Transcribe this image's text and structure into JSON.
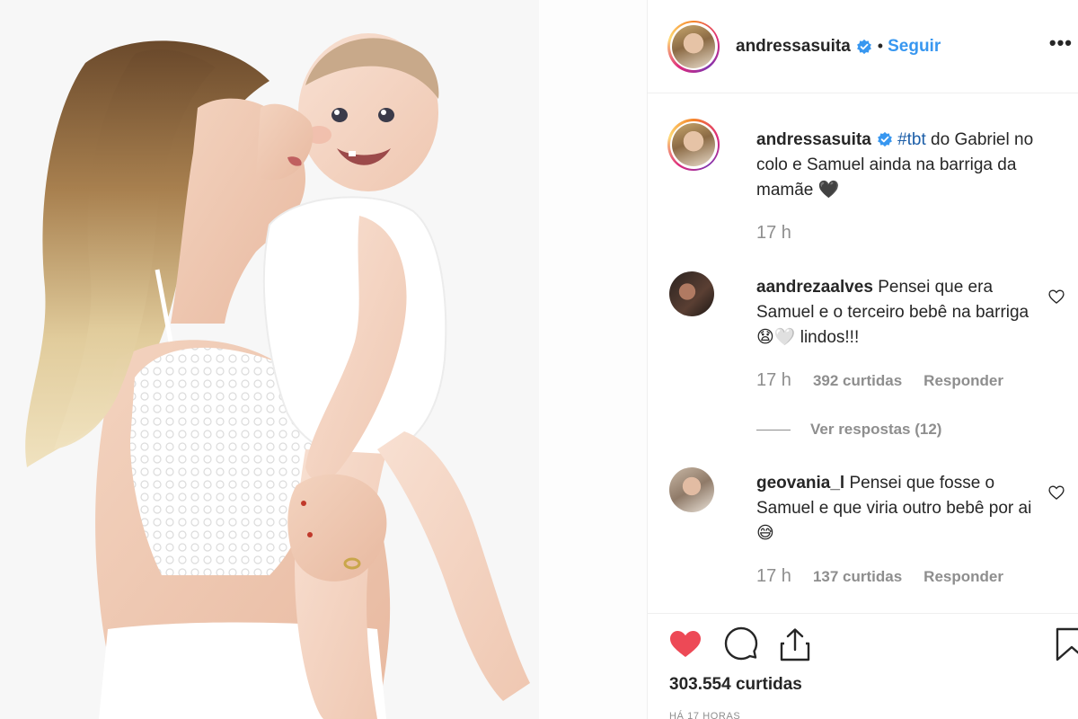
{
  "colors": {
    "link_blue": "#3897f0",
    "liked_red": "#ed4956",
    "verified_blue": "#3897f0",
    "secondary_text": "#8e8e8e"
  },
  "post": {
    "image_alt": "",
    "author": {
      "username": "andressasuita",
      "verified": true,
      "follow_label": "Seguir",
      "separator": "•",
      "more_icon": "more-horizontal-icon"
    },
    "caption": {
      "username": "andressasuita",
      "hashtag": "#tbt",
      "text": " do Gabriel no colo e Samuel ainda na barriga da mamãe 🖤",
      "time": "17 h"
    },
    "comments": [
      {
        "username": "aandrezaalves",
        "text": " Pensei que era Samuel e o terceiro bebê na barriga 😧🤍 lindos!!!",
        "time": "17 h",
        "likes": "392 curtidas",
        "reply_label": "Responder",
        "view_replies": "Ver respostas (12)"
      },
      {
        "username": "geovania_l",
        "text": " Pensei que fosse o Samuel e que viria outro bebê por ai😅",
        "time": "17 h",
        "likes": "137 curtidas",
        "reply_label": "Responder"
      }
    ],
    "actions": {
      "liked": true,
      "icons": [
        "heart-filled-icon",
        "comment-icon",
        "share-icon",
        "bookmark-icon"
      ],
      "likes_total": "303.554 curtidas",
      "posted_ago": "HÁ 17 HORAS"
    }
  }
}
